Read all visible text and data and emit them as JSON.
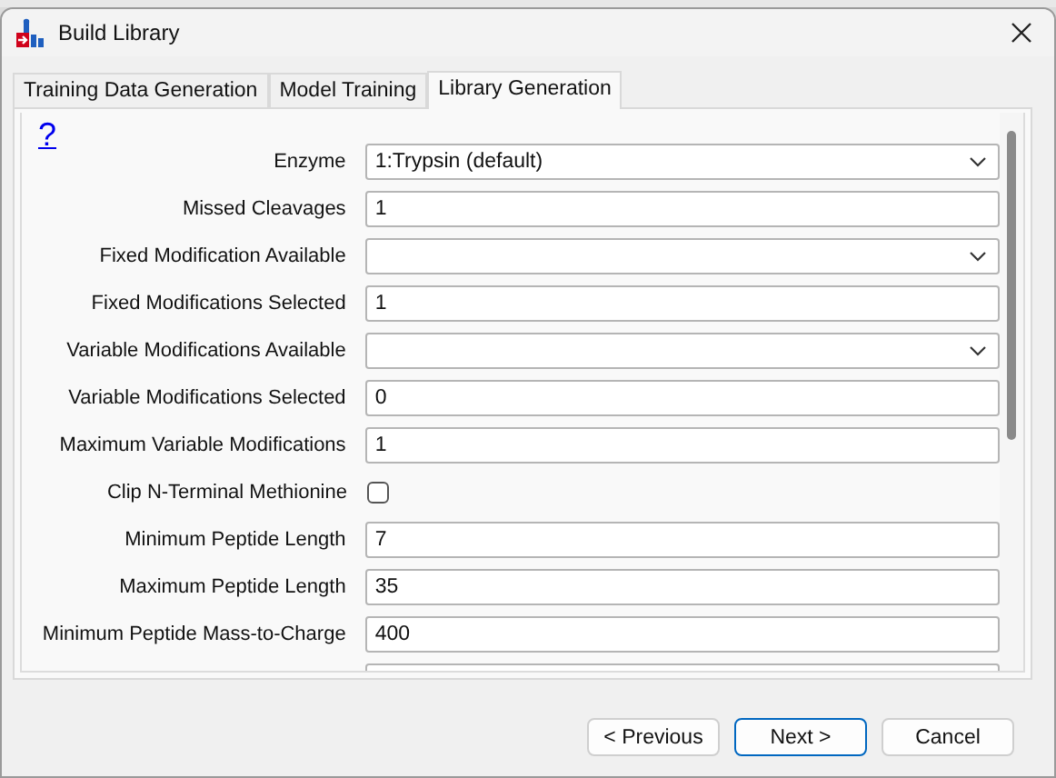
{
  "window": {
    "title": "Build Library"
  },
  "tabs": [
    {
      "label": "Training Data Generation",
      "selected": false
    },
    {
      "label": "Model Training",
      "selected": false
    },
    {
      "label": "Library Generation",
      "selected": true
    }
  ],
  "help_link": "?",
  "fields": [
    {
      "kind": "dropdown",
      "label": "Enzyme",
      "value": "1:Trypsin (default)"
    },
    {
      "kind": "text",
      "label": "Missed Cleavages",
      "value": "1"
    },
    {
      "kind": "dropdown",
      "label": "Fixed Modification Available"
    },
    {
      "kind": "text",
      "label": "Fixed Modifications Selected",
      "value": "1"
    },
    {
      "kind": "dropdown",
      "label": "Variable Modifications Available"
    },
    {
      "kind": "text",
      "label": "Variable Modifications Selected",
      "value": "0"
    },
    {
      "kind": "text",
      "label": "Maximum Variable Modifications",
      "value": "1"
    },
    {
      "kind": "checkbox",
      "label": "Clip N-Terminal Methionine",
      "checked": false
    },
    {
      "kind": "text",
      "label": "Minimum Peptide Length",
      "value": "7"
    },
    {
      "kind": "text",
      "label": "Maximum Peptide Length",
      "value": "35"
    },
    {
      "kind": "text",
      "label": "Minimum Peptide Mass-to-Charge",
      "value": "400"
    }
  ],
  "buttons": [
    "< Previous",
    "Next >",
    "Cancel"
  ]
}
